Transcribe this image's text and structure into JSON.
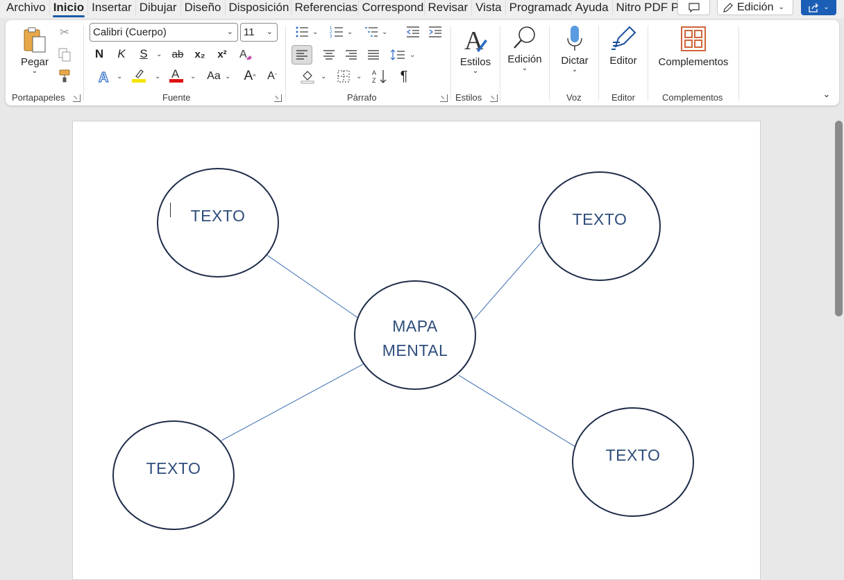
{
  "menu": {
    "tabs": [
      "Archivo",
      "Inicio",
      "Insertar",
      "Dibujar",
      "Diseño",
      "Disposición",
      "Referencias",
      "Correspondencia",
      "Revisar",
      "Vista",
      "Programador",
      "Ayuda",
      "Nitro PDF Pro"
    ],
    "active_tab": "Inicio",
    "editing_mode": "Edición"
  },
  "ribbon": {
    "clipboard": {
      "paste_label": "Pegar",
      "group_label": "Portapapeles"
    },
    "font": {
      "font_name": "Calibri (Cuerpo)",
      "font_size": "11",
      "bold": "N",
      "italic": "K",
      "underline": "S",
      "strikethrough": "ab",
      "subscript": "x₂",
      "superscript": "x²",
      "change_case": "Aa",
      "grow": "A",
      "shrink": "A",
      "group_label": "Fuente",
      "highlight_color": "#f5e400",
      "font_color": "#e01010"
    },
    "paragraph": {
      "group_label": "Párrafo",
      "pilcrow": "¶"
    },
    "styles": {
      "label": "Estilos",
      "group_label": "Estilos"
    },
    "editing": {
      "label": "Edición"
    },
    "voice": {
      "dictate_label": "Dictar",
      "group_label": "Voz"
    },
    "editor": {
      "label": "Editor",
      "group_label": "Editor"
    },
    "addins": {
      "label": "Complementos",
      "group_label": "Complementos"
    }
  },
  "document": {
    "mindmap": {
      "center": "MAPA\nMENTAL",
      "center_line1": "MAPA",
      "center_line2": "MENTAL",
      "nodes": [
        "TEXTO",
        "TEXTO",
        "TEXTO",
        "TEXTO"
      ],
      "node_outline_color": "#1f2d4a",
      "connector_color": "#4a78b8",
      "text_color": "#2e4d7b"
    }
  }
}
